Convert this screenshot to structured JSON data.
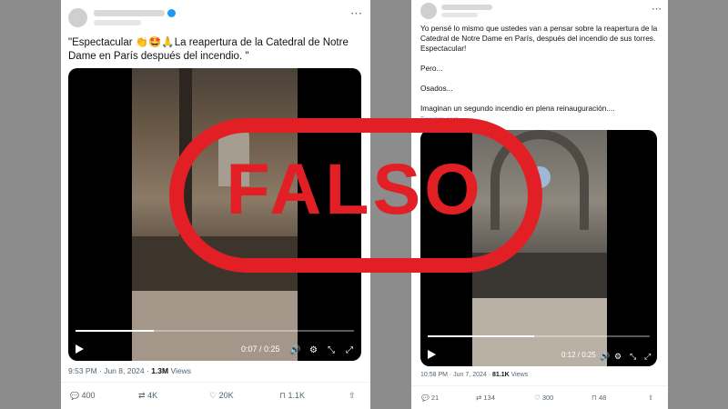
{
  "tweet1": {
    "text": "\"Espectacular 👏🤩🙏La reapertura de la Catedral de Notre Dame en París después del incendio. \"",
    "video": {
      "time": "0:07 / 0:25",
      "progress": 0.28
    },
    "meta": {
      "time": "9:53 PM · Jun 8, 2024 · ",
      "views_count": "1.3M",
      "views_label": " Views"
    },
    "actions": {
      "replies": "400",
      "reposts": "4K",
      "likes": "20K",
      "bookmarks": "1.1K"
    }
  },
  "tweet2": {
    "paragraphs": [
      "Yo pensé lo mismo que ustedes van a pensar  sobre la reapertura de la Catedral de Notre Dame en París, después del incendio de sus torres. Espectacular!",
      "Pero...",
      "Osados...",
      "Imaginan un segundo incendio en plena reinauguración...."
    ],
    "translate": "Translate post",
    "video": {
      "time": "0:12 / 0:25",
      "progress": 0.48
    },
    "meta": {
      "time": "10:58 PM · Jun 7, 2024 · ",
      "views_count": "81.1K",
      "views_label": " Views"
    },
    "actions": {
      "replies": "21",
      "reposts": "134",
      "likes": "300",
      "bookmarks": "48"
    }
  },
  "stamp": {
    "text": "FALSO",
    "color": "#e31f26"
  },
  "icons": {
    "more": "⋯",
    "play": "play-icon",
    "reply": "💬",
    "repost": "⇄",
    "like": "♡",
    "bookmark": "⊓",
    "share": "⇧",
    "volume": "🔊",
    "settings": "⚙",
    "collapse": "⤡",
    "fullscreen": "⤢"
  }
}
